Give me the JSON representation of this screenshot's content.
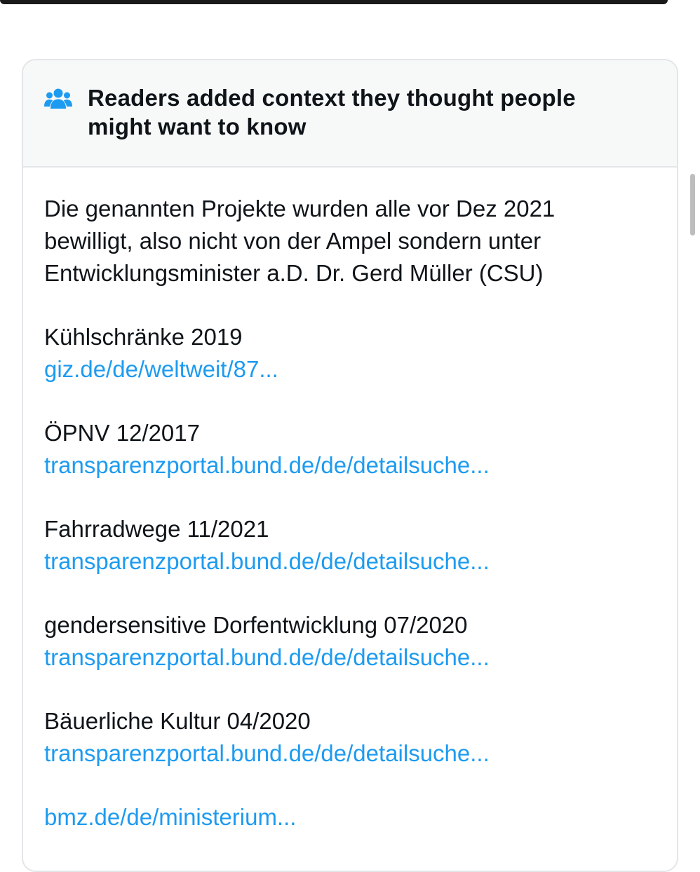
{
  "note": {
    "title": "Readers added context they thought people might want to know",
    "title_lines": [
      "Readers added context they thought people",
      "might want to know"
    ],
    "icon": "people-icon",
    "intro_lines": [
      "Die genannten Projekte wurden alle vor Dez 2021",
      "bewilligt, also nicht von der Ampel sondern unter",
      "Entwicklungsminister a.D. Dr. Gerd Müller (CSU)"
    ],
    "items": [
      {
        "label": "Kühlschränke 2019",
        "link": "giz.de/de/weltweit/87..."
      },
      {
        "label": "ÖPNV 12/2017",
        "link": "transparenzportal.bund.de/de/detailsuche..."
      },
      {
        "label": "Fahrradwege 11/2021",
        "link": "transparenzportal.bund.de/de/detailsuche..."
      },
      {
        "label": "gendersensitive Dorfentwicklung 07/2020",
        "link": "transparenzportal.bund.de/de/detailsuche..."
      },
      {
        "label": "Bäuerliche Kultur 04/2020",
        "link": "transparenzportal.bund.de/de/detailsuche..."
      }
    ],
    "final_link": "bmz.de/de/ministerium..."
  },
  "colors": {
    "link": "#1d9bf0",
    "text": "#0f1419",
    "header_bg": "#f7f9f9",
    "border": "#e3e6e8",
    "icon": "#1d9bf0"
  }
}
